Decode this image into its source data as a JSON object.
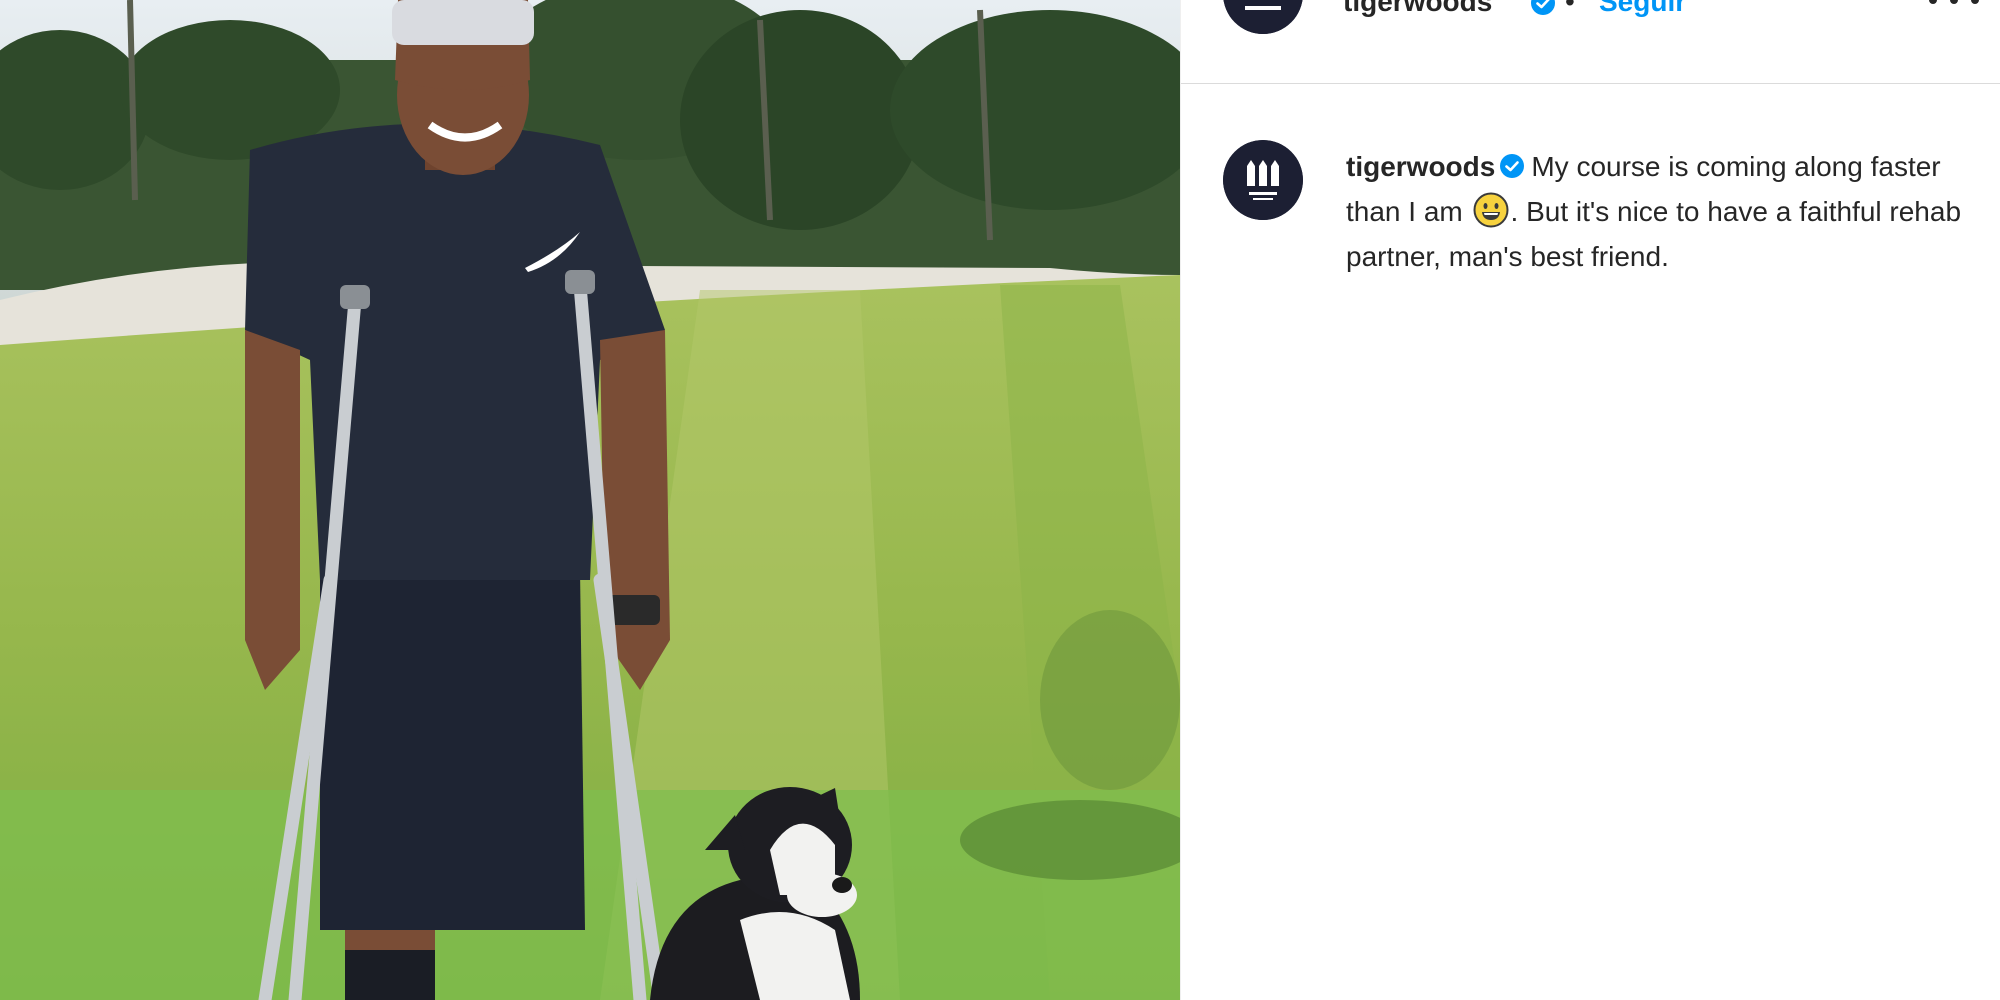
{
  "post": {
    "username": "tigerwoods",
    "separator": "•",
    "follow_label": "Seguir",
    "caption": {
      "part1": "My course is coming along faster than I am",
      "part2": ". But it's nice to have a faithful rehab partner, man's best friend."
    }
  },
  "icons": {
    "verified": "verified-badge-icon",
    "more": "more-options-icon",
    "emoji": "grinning-face-emoji-icon"
  },
  "colors": {
    "accent": "#0095f6",
    "avatar_bg": "#1c1f33",
    "text": "#262626"
  }
}
